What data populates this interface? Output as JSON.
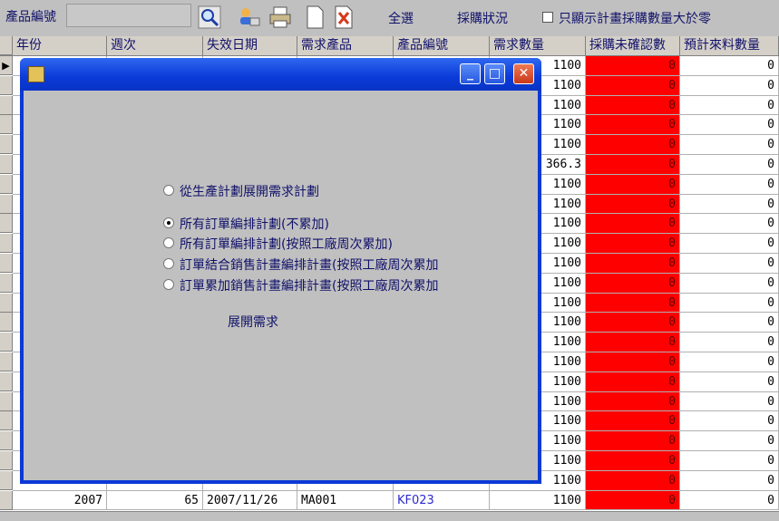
{
  "toolbar": {
    "product_code_label": "產品編號",
    "product_code_value": "",
    "icons": [
      "search-icon",
      "user-edit-icon",
      "print-icon",
      "new-document-icon",
      "cancel-document-icon"
    ],
    "select_all_label": "全選",
    "purchase_status_label": "採購狀況",
    "filter_checkbox_label": "只顯示計畫採購數量大於零",
    "filter_checked": false
  },
  "grid": {
    "columns": [
      "年份",
      "週次",
      "失效日期",
      "需求產品",
      "產品編號",
      "需求數量",
      "採購未確認數",
      "預計來料數量"
    ],
    "rows": [
      {
        "qty": "1100",
        "unconfirmed": "0",
        "incoming": "0"
      },
      {
        "qty": "1100",
        "unconfirmed": "0",
        "incoming": "0"
      },
      {
        "qty": "1100",
        "unconfirmed": "0",
        "incoming": "0"
      },
      {
        "qty": "1100",
        "unconfirmed": "0",
        "incoming": "0"
      },
      {
        "qty": "1100",
        "unconfirmed": "0",
        "incoming": "0"
      },
      {
        "qty": "366.3",
        "unconfirmed": "0",
        "incoming": "0"
      },
      {
        "qty": "1100",
        "unconfirmed": "0",
        "incoming": "0"
      },
      {
        "qty": "1100",
        "unconfirmed": "0",
        "incoming": "0"
      },
      {
        "qty": "1100",
        "unconfirmed": "0",
        "incoming": "0"
      },
      {
        "qty": "1100",
        "unconfirmed": "0",
        "incoming": "0"
      },
      {
        "qty": "1100",
        "unconfirmed": "0",
        "incoming": "0"
      },
      {
        "qty": "1100",
        "unconfirmed": "0",
        "incoming": "0"
      },
      {
        "qty": "1100",
        "unconfirmed": "0",
        "incoming": "0"
      },
      {
        "qty": "1100",
        "unconfirmed": "0",
        "incoming": "0"
      },
      {
        "qty": "1100",
        "unconfirmed": "0",
        "incoming": "0"
      },
      {
        "qty": "1100",
        "unconfirmed": "0",
        "incoming": "0"
      },
      {
        "qty": "1100",
        "unconfirmed": "0",
        "incoming": "0"
      },
      {
        "qty": "1100",
        "unconfirmed": "0",
        "incoming": "0"
      },
      {
        "qty": "1100",
        "unconfirmed": "0",
        "incoming": "0"
      },
      {
        "qty": "1100",
        "unconfirmed": "0",
        "incoming": "0"
      },
      {
        "qty": "1100",
        "unconfirmed": "0",
        "incoming": "0"
      },
      {
        "qty": "1100",
        "unconfirmed": "0",
        "incoming": "0"
      },
      {
        "year": "2007",
        "week": "65",
        "expiry": "2007/11/26",
        "product": "MA001",
        "code": "KF023",
        "qty": "1100",
        "unconfirmed": "0",
        "incoming": "0"
      }
    ],
    "highlight_color": "#ff0000",
    "link_color": "#2a2ad0"
  },
  "dialog": {
    "window_buttons": [
      "minimize-icon",
      "maximize-icon",
      "close-icon"
    ],
    "options": [
      {
        "label": "從生產計劃展開需求計劃",
        "selected": false
      },
      {
        "label": "所有訂單編排計劃(不累加)",
        "selected": true
      },
      {
        "label": "所有訂單編排計劃(按照工廠周次累加)",
        "selected": false
      },
      {
        "label": "訂單結合銷售計畫編排計畫(按照工廠周次累加",
        "selected": false
      },
      {
        "label": "訂單累加銷售計畫編排計畫(按照工廠周次累加",
        "selected": false
      }
    ],
    "action_label": "展開需求",
    "titlebar_color": "#0b39d6"
  }
}
